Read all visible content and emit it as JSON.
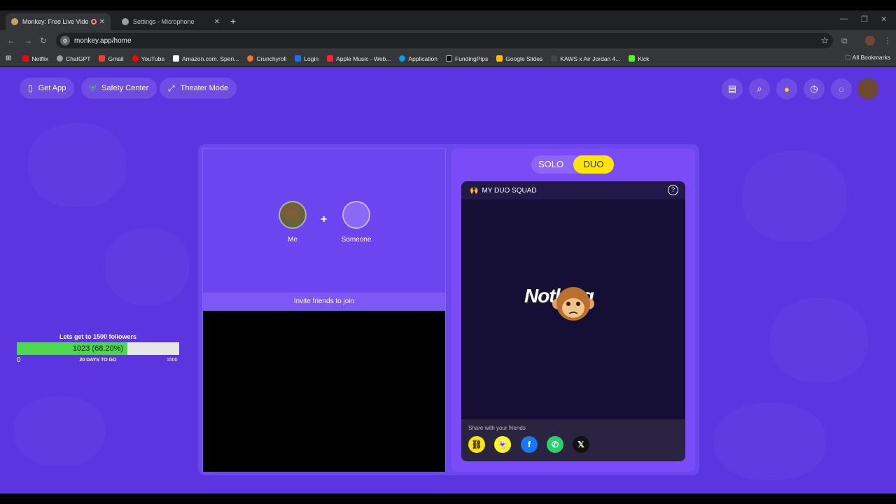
{
  "browser": {
    "tabs": [
      {
        "title": "Monkey: Free Live Video Ch",
        "active": true
      },
      {
        "title": "Settings - Microphone",
        "active": false
      }
    ],
    "url": "monkey.app/home",
    "bookmarks": [
      "Netflix",
      "ChatGPT",
      "Gmail",
      "YouTube",
      "Amazon.com. Spen...",
      "Crunchyroll",
      "Login",
      "Apple Music - Web...",
      "Application",
      "FundingPips",
      "Google Slides",
      "KAWS x Air Jordan 4...",
      "Kick"
    ],
    "all_bookmarks": "All Bookmarks"
  },
  "header": {
    "get_app": "Get App",
    "safety_center": "Safety Center",
    "theater_mode": "Theater Mode"
  },
  "followers": {
    "title": "Lets get to 1500 followers",
    "value_label": "1023 (68.20%)",
    "progress": 0.682,
    "min": "0",
    "days": "20 DAYS TO GO",
    "max": "1500"
  },
  "match": {
    "me": "Me",
    "someone": "Someone",
    "invite": "Invite friends to join"
  },
  "duo": {
    "solo": "SOLO",
    "duo": "DUO",
    "squad_title": "MY DUO SQUAD",
    "nothing": "Nothing",
    "share_label": "Share with your friends"
  }
}
